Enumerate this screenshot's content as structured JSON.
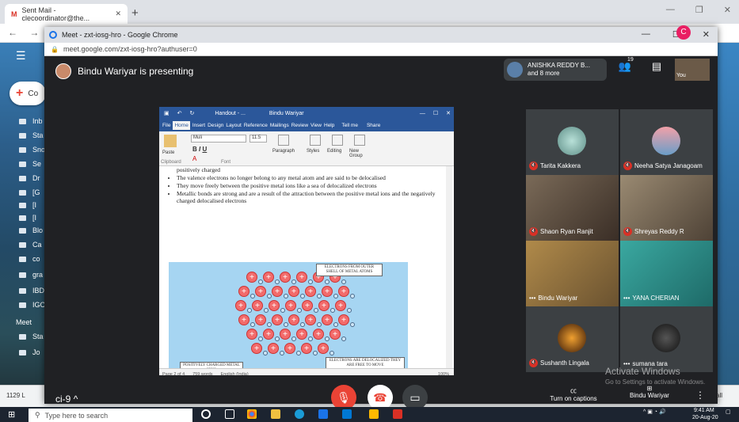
{
  "gmail_tab": {
    "title": "Sent Mail - clecoordinator@the...",
    "close": "✕"
  },
  "gmail_new_tab": "+",
  "gmail_window_controls": [
    "—",
    "❐",
    "✕"
  ],
  "gmail_nav": "← →",
  "gmail_sidebar": {
    "compose_label": "Co",
    "items": [
      "Inb",
      "Sta",
      "Sno",
      "Se",
      "Dr",
      "[G",
      "[I",
      "[I",
      "Blo",
      "Ca",
      "co",
      "gra",
      "IBD",
      "IGC"
    ],
    "meet_label": "Meet",
    "meet_items": [
      "Sta",
      "Jo"
    ]
  },
  "gmail_bottom": {
    "left": "1129 L",
    "right": "all"
  },
  "meet_window": {
    "title": "Meet - zxt-iosg-hro - Google Chrome",
    "url": "meet.google.com/zxt-iosg-hro?authuser=0",
    "controls": [
      "—",
      "☐",
      "✕"
    ]
  },
  "avatar_badge": "C",
  "presenter_text": "Bindu Wariyar is presenting",
  "participants_pill": {
    "line1": "ANISHKA REDDY B...",
    "line2": "and 8 more",
    "count": "19"
  },
  "you_label": "You",
  "word": {
    "title": "Handout - ...",
    "user": "Bindu Wariyar",
    "tabs": [
      "File",
      "Home",
      "Insert",
      "Design",
      "Layout",
      "Reference",
      "Mailings",
      "Review",
      "View",
      "Help",
      "Tell me",
      "Share"
    ],
    "ribbon": {
      "font": "Muli",
      "size": "11.5",
      "paste": "Paste",
      "paragraph": "Paragraph",
      "styles": "Styles",
      "editing": "Editing",
      "new_group": "New Group",
      "clipboard": "Clipboard",
      "font_group": "Font"
    },
    "bullets": [
      "positively charged",
      "The valence electrons no longer belong to any metal atom and are said to be delocalised",
      "They move freely between the positive metal ions like a sea of delocalized electrons",
      "Metallic bonds are strong and are a result of the attraction between the positive metal ions and the negatively charged delocalised electrons"
    ],
    "diagram_labels": {
      "top": "ELECTRONS FROM OUTER SHELL OF METAL ATOMS",
      "bottom_left": "POSITIVELY CHARGED METAL IONS",
      "bottom_right": "ELECTRONS ARE DELOCALIZED THEY ARE FREE TO MOVE"
    },
    "status": {
      "page": "Page 2 of 4",
      "words": "759 words",
      "lang": "English (India)",
      "zoom": "100%"
    }
  },
  "participants": [
    {
      "name": "Tarita Kakkera",
      "muted": true
    },
    {
      "name": "Neeha Satya Janagoam",
      "muted": true
    },
    {
      "name": "Shaon Ryan Ranjit",
      "muted": true
    },
    {
      "name": "Shreyas Reddy R",
      "muted": true
    },
    {
      "name": "Bindu Wariyar",
      "muted": false
    },
    {
      "name": "YANA CHERIAN",
      "muted": false
    },
    {
      "name": "Sushanth Lingala",
      "muted": true
    },
    {
      "name": "sumana tara",
      "muted": false
    }
  ],
  "bottom_bar": {
    "meeting_code": "ci-9",
    "captions_label": "Turn on captions",
    "presenting_label": "Bindu Wariyar"
  },
  "watermark": {
    "line1": "Activate Windows",
    "line2": "Go to Settings to activate Windows."
  },
  "taskbar": {
    "search_placeholder": "Type here to search",
    "time": "9:41 AM",
    "date": "20-Aug-20"
  },
  "colors": {
    "meet_bg": "#202124",
    "word_blue": "#2b579a",
    "end_red": "#ea4335",
    "muted_red": "#d93025"
  }
}
